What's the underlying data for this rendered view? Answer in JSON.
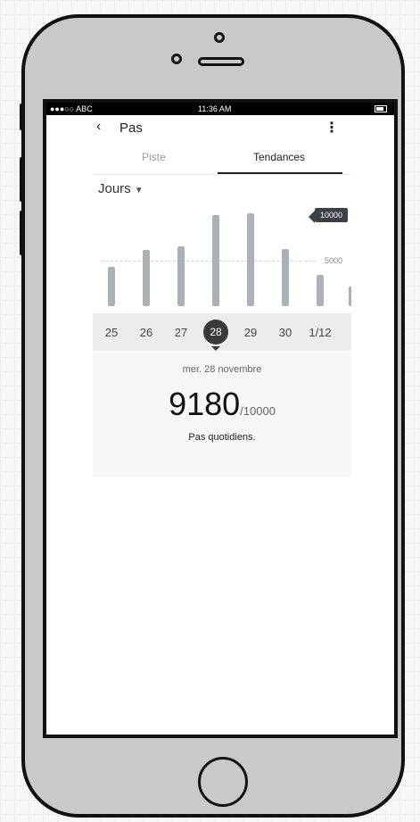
{
  "statusbar": {
    "carrier": "●●●○○ ABC",
    "time": "11:36 AM"
  },
  "header": {
    "back_icon": "‹",
    "title": "Pas",
    "menu_icon": "⋮"
  },
  "tabs": [
    {
      "label": "Piste",
      "active": false
    },
    {
      "label": "Tendances",
      "active": true
    }
  ],
  "period": {
    "label": "Jours",
    "arrow": "▼"
  },
  "chart_data": {
    "type": "bar",
    "categories": [
      "25",
      "26",
      "27",
      "28",
      "29",
      "30",
      "1/12"
    ],
    "values": [
      4200,
      6000,
      6400,
      9800,
      9900,
      6100,
      3300
    ],
    "goal_label": "10000",
    "reference_label": "5000",
    "ylim": [
      0,
      11000
    ]
  },
  "days": [
    "25",
    "26",
    "27",
    "28",
    "29",
    "30",
    "1/12"
  ],
  "selected_index": 3,
  "detail": {
    "date": "mer. 28 novembre",
    "steps": "9180",
    "goal": "/10000",
    "caption": "Pas quotidiens."
  },
  "colors": {
    "bar": "#aab2b8",
    "selected": "#3a3a3a",
    "badge": "#3b4147"
  }
}
